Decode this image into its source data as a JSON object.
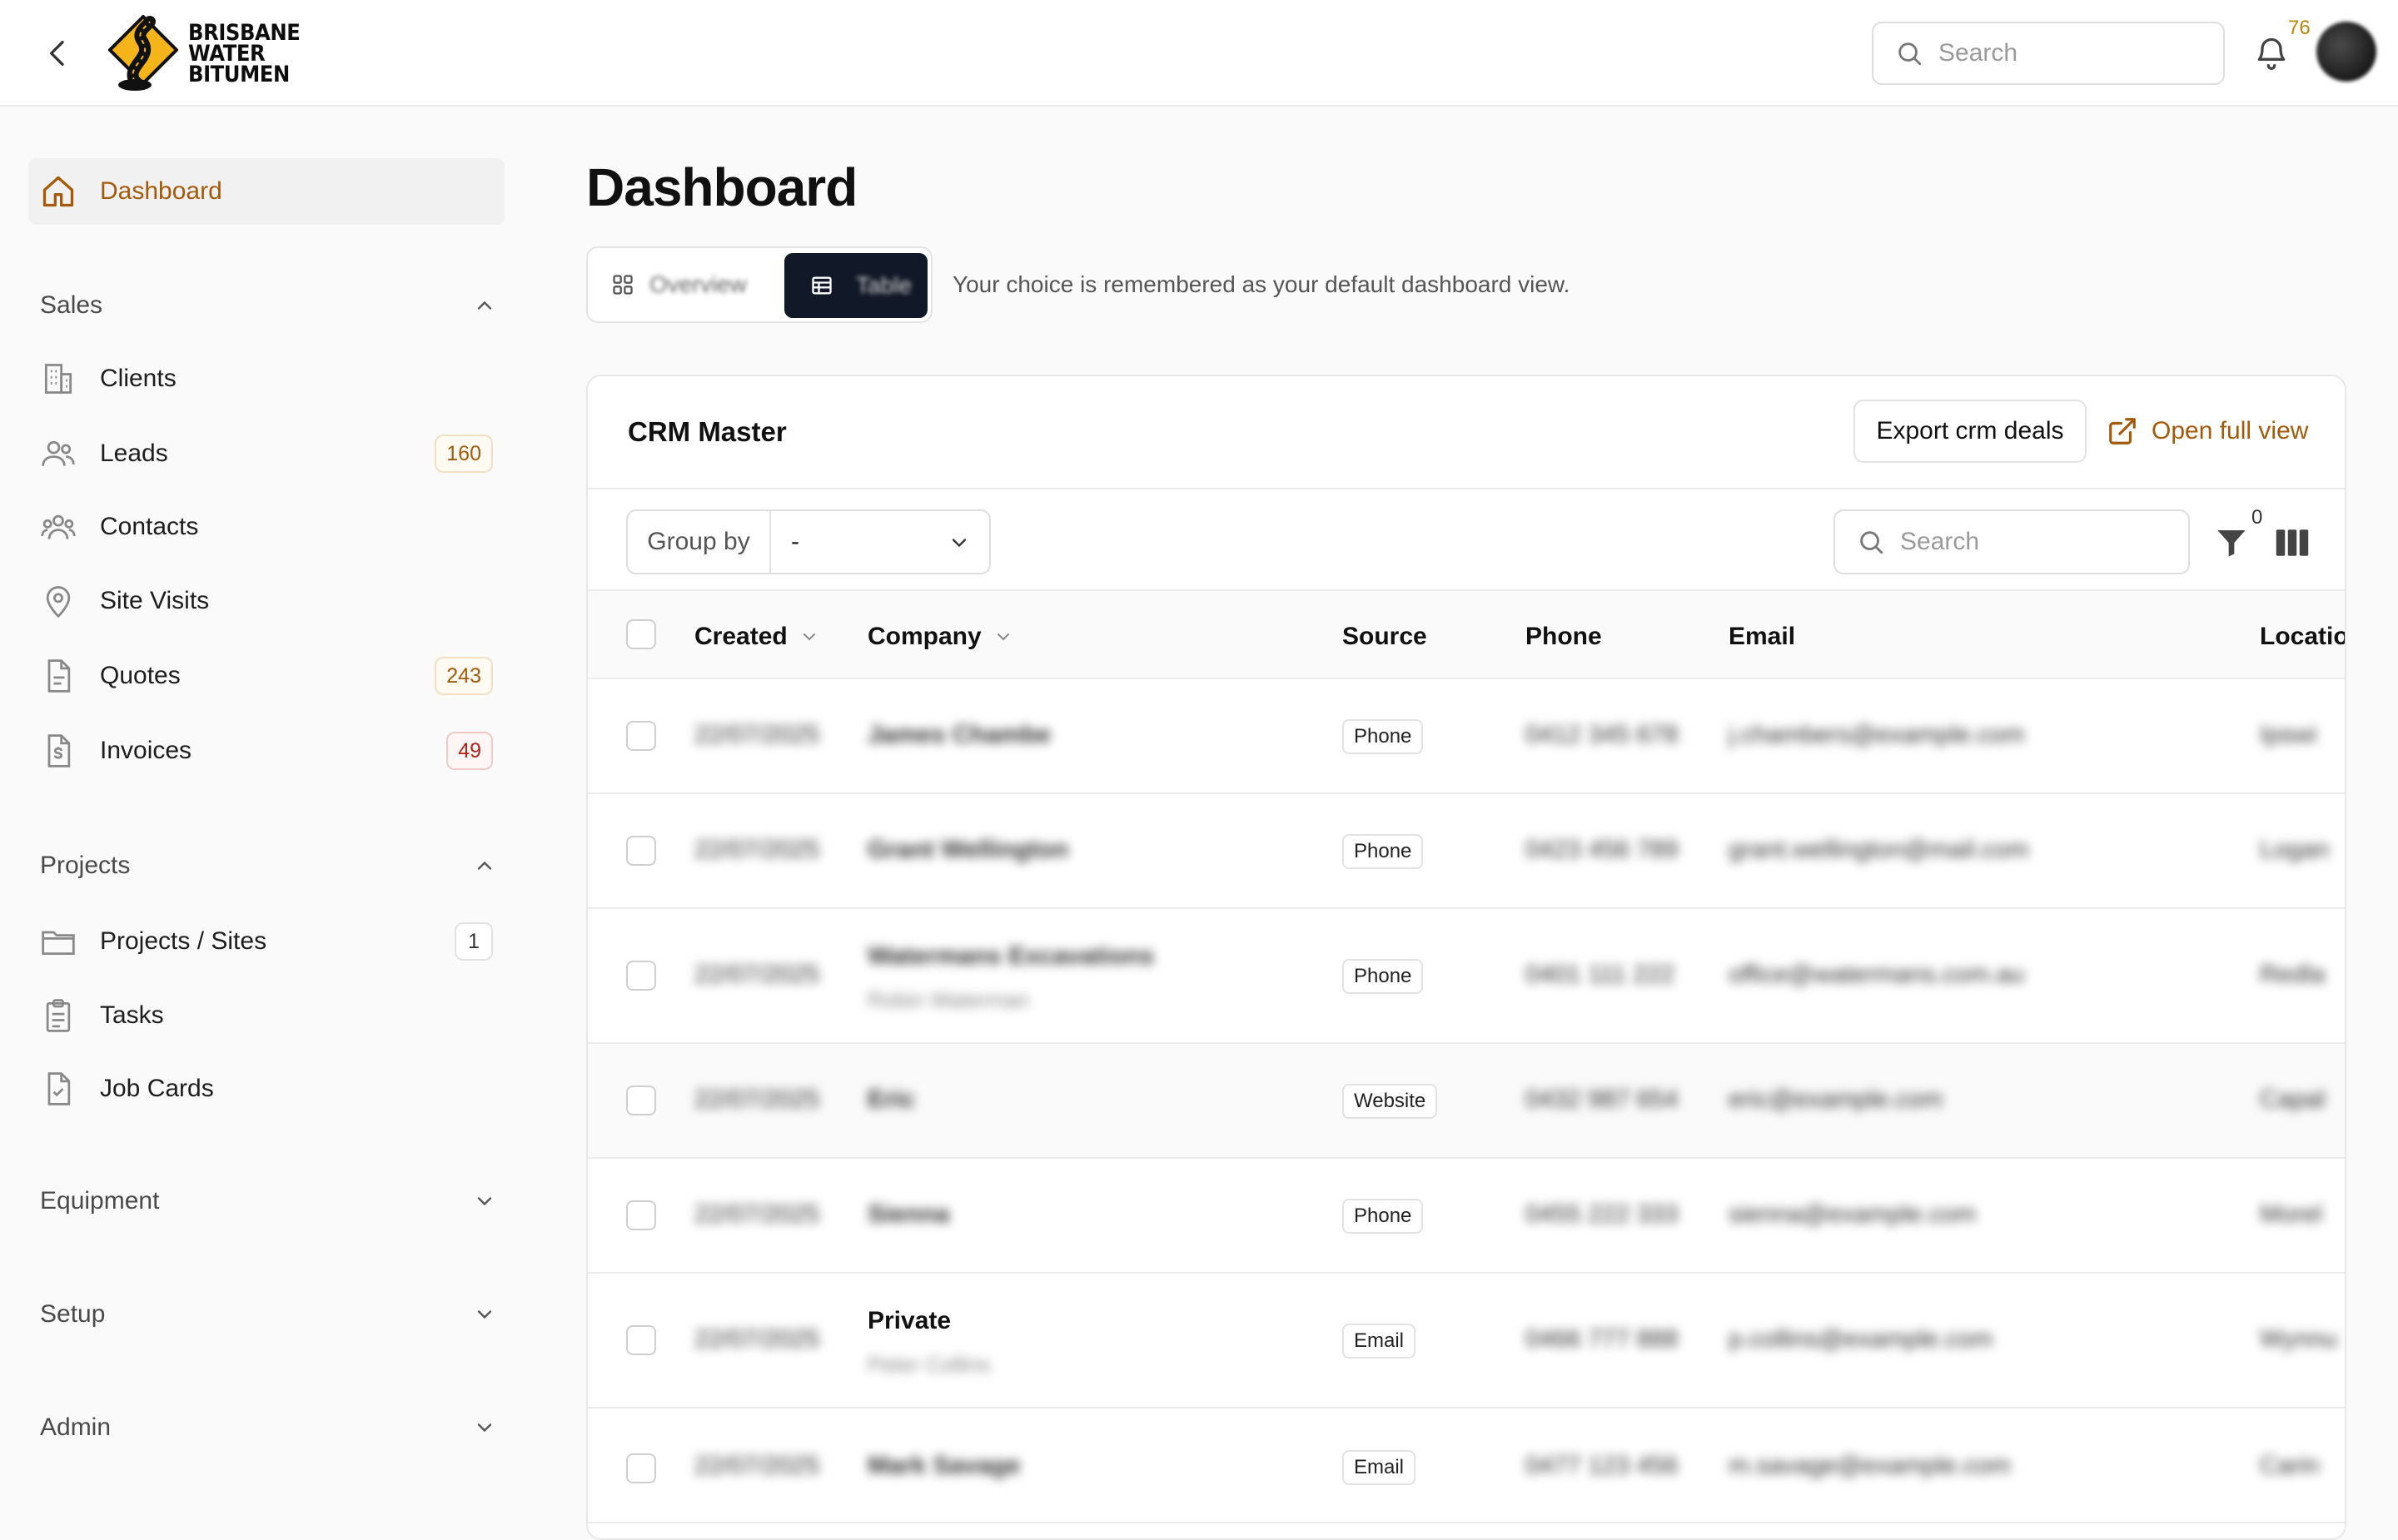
{
  "header": {
    "logo_lines": [
      "BRISBANE",
      "WATER",
      "BITUMEN"
    ],
    "search_placeholder": "Search",
    "notification_count": "76"
  },
  "sidebar": {
    "dashboard_label": "Dashboard",
    "sections": {
      "sales": "Sales",
      "projects": "Projects",
      "equipment": "Equipment",
      "setup": "Setup",
      "admin": "Admin"
    },
    "items": {
      "clients": {
        "label": "Clients"
      },
      "leads": {
        "label": "Leads",
        "badge": "160"
      },
      "contacts": {
        "label": "Contacts"
      },
      "site_visits": {
        "label": "Site Visits"
      },
      "quotes": {
        "label": "Quotes",
        "badge": "243"
      },
      "invoices": {
        "label": "Invoices",
        "badge": "49"
      },
      "projects_sites": {
        "label": "Projects / Sites",
        "badge": "1"
      },
      "tasks": {
        "label": "Tasks"
      },
      "job_cards": {
        "label": "Job Cards"
      }
    }
  },
  "main": {
    "title": "Dashboard",
    "view_toggle": {
      "overview_label": "Overview",
      "table_label": "Table",
      "active": "table"
    },
    "toggle_note": "Your choice is remembered as your default dashboard view.",
    "card": {
      "title": "CRM Master",
      "export_label": "Export crm deals",
      "open_full_label": "Open full view",
      "group_by_label": "Group by",
      "group_by_value": "-",
      "search_placeholder": "Search",
      "filter_count": "0",
      "columns": {
        "created": "Created",
        "company": "Company",
        "source": "Source",
        "phone": "Phone",
        "email": "Email",
        "location": "Location"
      },
      "rows": [
        {
          "created": "22/07/2025",
          "company": "James Chambe",
          "subtitle": "",
          "source": "Phone",
          "phone": "0412 345 678",
          "email": "j.chambers@example.com",
          "location": "Ipswi"
        },
        {
          "created": "22/07/2025",
          "company": "Grant Wellington",
          "subtitle": "",
          "source": "Phone",
          "phone": "0423 456 789",
          "email": "grant.wellington@mail.com",
          "location": "Logan"
        },
        {
          "created": "22/07/2025",
          "company": "Watermans Excavations",
          "subtitle": "Robin Waterman",
          "source": "Phone",
          "phone": "0401 111 222",
          "email": "office@watermans.com.au",
          "location": "Redla"
        },
        {
          "created": "22/07/2025",
          "company": "Eric",
          "subtitle": "",
          "source": "Website",
          "phone": "0432 987 654",
          "email": "eric@example.com",
          "location": "Capal"
        },
        {
          "created": "22/07/2025",
          "company": "Sienna",
          "subtitle": "",
          "source": "Phone",
          "phone": "0455 222 333",
          "email": "sienna@example.com",
          "location": "Morel"
        },
        {
          "created": "22/07/2025",
          "company": "Private",
          "subtitle": "Peter Collins",
          "source": "Email",
          "phone": "0466 777 888",
          "email": "p.collins@example.com",
          "location": "Wynnu"
        },
        {
          "created": "22/07/2025",
          "company": "Mark Savage",
          "subtitle": "",
          "source": "Email",
          "phone": "0477 123 456",
          "email": "m.savage@example.com",
          "location": "Carin"
        }
      ]
    }
  }
}
